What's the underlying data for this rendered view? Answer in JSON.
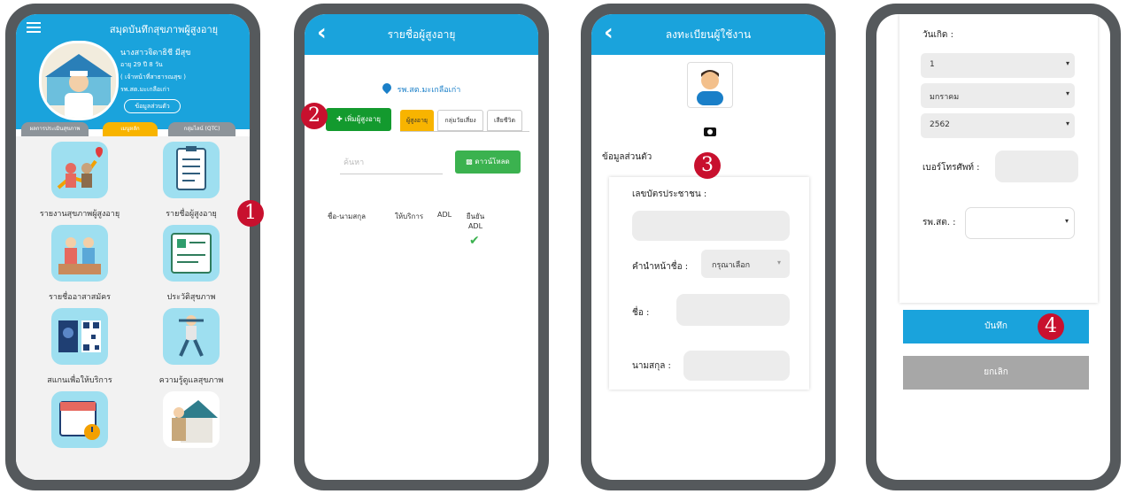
{
  "screen1": {
    "title": "สมุดบันทึกสุขภาพผู้สูงอายุ",
    "profile": {
      "name": "นางสาวจิดาธิชี มีสุข",
      "age": "อายุ 29 ปี 8 วัน",
      "role": "( เจ้าหน้าที่สาธารณสุข )",
      "facility": "รพ.สต.มะเกลือเก่า",
      "profile_button": "ข้อมูลส่วนตัว"
    },
    "tabs": [
      "ผลการประเมินสุขภาพ",
      "เมนูหลัก",
      "กลุ่มไลน์ (QTC)"
    ],
    "menu": [
      {
        "label": "รายงานสุขภาพผู้สูงอายุ",
        "icon": "elderly-chart-icon"
      },
      {
        "label": "รายชื่อผู้สูงอายุ",
        "icon": "clipboard-icon"
      },
      {
        "label": "รายชื่ออาสาสมัคร",
        "icon": "volunteers-icon"
      },
      {
        "label": "ประวัติสุขภาพ",
        "icon": "health-record-icon"
      },
      {
        "label": "สแกนเพื่อให้บริการ",
        "icon": "qr-scan-icon"
      },
      {
        "label": "ความรู้ดูแลสุขภาพ",
        "icon": "exercise-icon"
      },
      {
        "label": "",
        "icon": "calendar-icon"
      },
      {
        "label": "",
        "icon": "home-visit-icon"
      }
    ]
  },
  "screen2": {
    "title": "รายชื่อผู้สูงอายุ",
    "location": "รพ.สต.มะเกลือเก่า",
    "add_button": "เพิ่มผู้สูงอายุ",
    "tabs": [
      "ผู้สูงอายุ",
      "กลุ่มวัยเสี่ยง",
      "เสียชีวิต"
    ],
    "search_placeholder": "ค้นหา",
    "download_button": "ดาวน์โหลด",
    "columns": [
      "ชื่อ-นามสกุล",
      "ให้บริการ",
      "ADL",
      "ยืนยัน ADL"
    ]
  },
  "screen3": {
    "title": "ลงทะเบียนผู้ใช้งาน",
    "section": "ข้อมูลส่วนตัว",
    "id_label": "เลขบัตรประชาชน :",
    "prefix_label": "คำนำหน้าชื่อ :",
    "prefix_value": "กรุณาเลือก",
    "name_label": "ชื่อ :",
    "surname_label": "นามสกุล :"
  },
  "screen4": {
    "birth_label": "วันเกิด :",
    "day": "1",
    "month": "มกราคม",
    "year": "2562",
    "phone_label": "เบอร์โทรศัพท์ :",
    "hospital_label": "รพ.สต. :",
    "save_button": "บันทึก",
    "cancel_button": "ยกเลิก"
  },
  "markers": [
    "1",
    "2",
    "3",
    "4"
  ],
  "colors": {
    "header": "#1aa3dc",
    "frame": "#55595c",
    "marker": "#c8102e",
    "add": "#139a2e",
    "tab_active": "#f8b400"
  }
}
